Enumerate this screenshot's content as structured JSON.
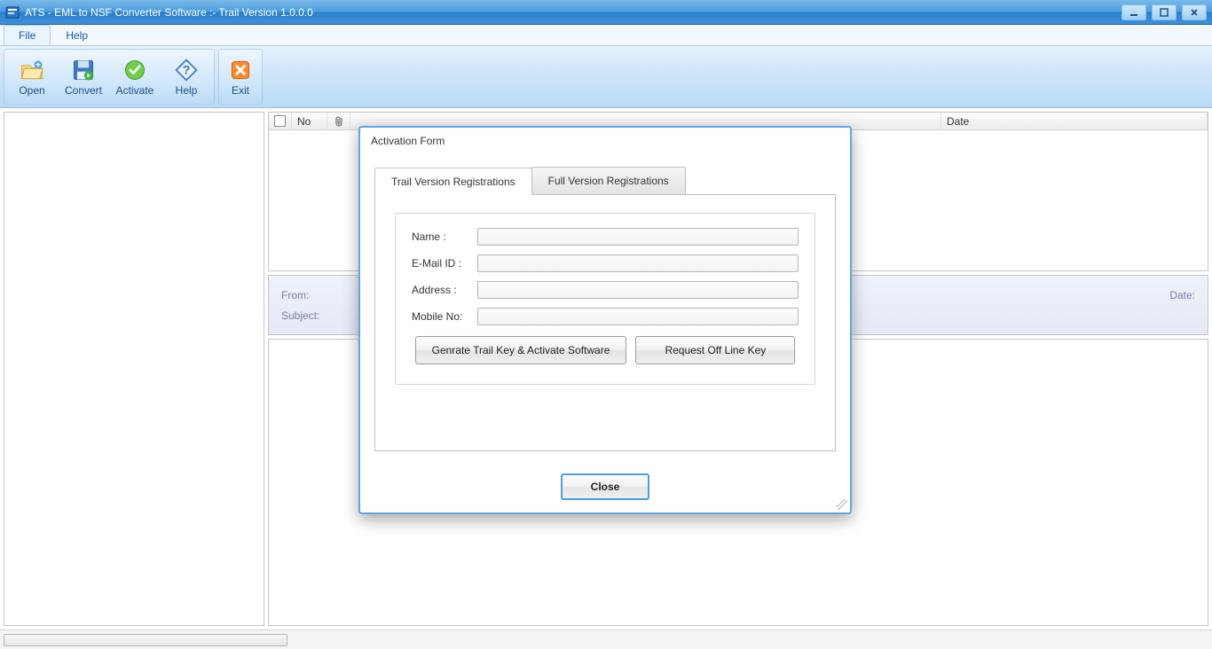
{
  "window": {
    "title": "ATS - EML to NSF Converter Software :- Trail Version 1.0.0.0"
  },
  "menu": {
    "file": "File",
    "help": "Help"
  },
  "toolbar": {
    "open": "Open",
    "convert": "Convert",
    "activate": "Activate",
    "help": "Help",
    "exit": "Exit"
  },
  "list": {
    "col_no": "No",
    "col_date": "Date"
  },
  "preview": {
    "from_label": "From:",
    "subject_label": "Subject:",
    "date_label": "Date:"
  },
  "dialog": {
    "title": "Activation Form",
    "tab_trail": "Trail Version Registrations",
    "tab_full": "Full Version Registrations",
    "name_label": "Name :",
    "email_label": "E-Mail ID :",
    "address_label": "Address :",
    "mobile_label": "Mobile No:",
    "name_value": "",
    "email_value": "",
    "address_value": "",
    "mobile_value": "",
    "btn_generate": "Genrate Trail Key & Activate Software",
    "btn_request": "Request Off Line Key",
    "btn_close": "Close"
  }
}
